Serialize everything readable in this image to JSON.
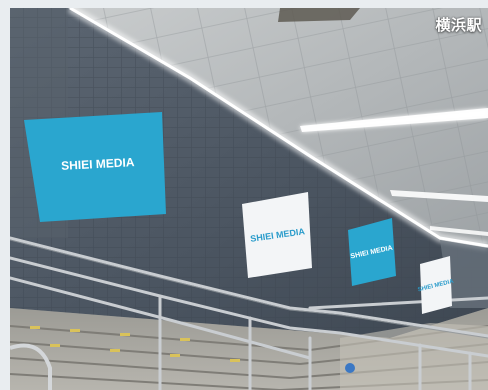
{
  "station_label": "横浜駅",
  "posters": [
    {
      "text": "SHIEI MEDIA",
      "color": "#2aa6cf",
      "text_color": "#ffffff"
    },
    {
      "text": "SHIEI MEDIA",
      "color": "#f3f5f7",
      "text_color": "#2a9ccb"
    },
    {
      "text": "SHIEI MEDIA",
      "color": "#2aa6cf",
      "text_color": "#ffffff"
    },
    {
      "text": "SHIEI MEDIA",
      "color": "#f3f5f7",
      "text_color": "#2a9ccb"
    }
  ],
  "colors": {
    "wall": "#4b5663",
    "ceiling": "#b8bcbe",
    "light_strip": "#ffffff",
    "stairs": "#a9a8a3",
    "railing": "#c9cdd1"
  }
}
